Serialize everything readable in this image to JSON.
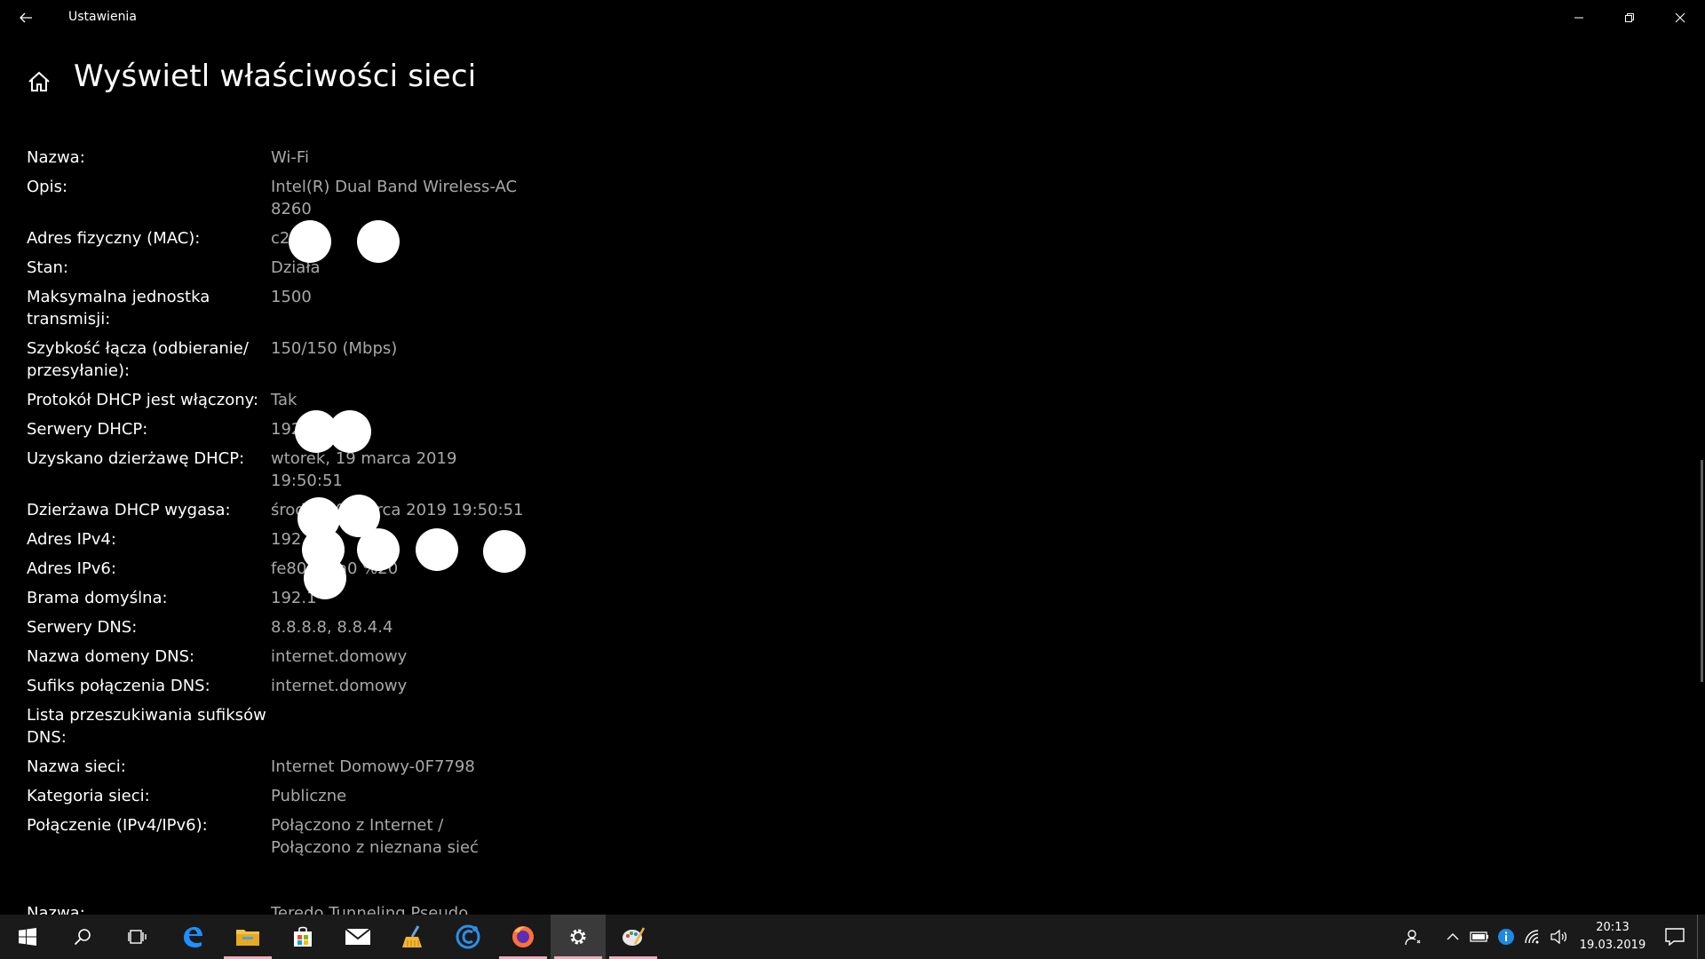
{
  "window": {
    "title": "Ustawienia"
  },
  "header": {
    "title": "Wyświetl właściwości sieci"
  },
  "properties": [
    {
      "label": "Nazwa:",
      "value": "Wi-Fi"
    },
    {
      "label": "Opis:",
      "value": "Intel(R) Dual Band Wireless-AC 8260"
    },
    {
      "label": "Adres fizyczny (MAC):",
      "value": "c2 40:6"
    },
    {
      "label": "Stan:",
      "value": "Działa"
    },
    {
      "label": "Maksymalna jednostka transmisji:",
      "value": "1500"
    },
    {
      "label": "Szybkość łącza (odbieranie/ przesyłanie):",
      "value": "150/150 (Mbps)"
    },
    {
      "label": "Protokół DHCP jest włączony:",
      "value": "Tak"
    },
    {
      "label": "Serwery DHCP:",
      "value": "192."
    },
    {
      "label": "Uzyskano dzierżawę DHCP:",
      "value": "wtorek, 19 marca 2019 19:50:51"
    },
    {
      "label": "Dzierżawa DHCP wygasa:",
      "value": "środa, 20 marca 2019 19:50:51"
    },
    {
      "label": "Adres IPv4:",
      "value": "192."
    },
    {
      "label": "Adres IPv6:",
      "value": "fe80: .2 a0 %20"
    },
    {
      "label": "Brama domyślna:",
      "value": "192.1"
    },
    {
      "label": "Serwery DNS:",
      "value": "8.8.8.8, 8.8.4.4"
    },
    {
      "label": "Nazwa domeny DNS:",
      "value": "internet.domowy"
    },
    {
      "label": "Sufiks połączenia DNS:",
      "value": "internet.domowy"
    },
    {
      "label": "Lista przeszukiwania sufiksów DNS:",
      "value": ""
    },
    {
      "label": "Nazwa sieci:",
      "value": "Internet Domowy-0F7798"
    },
    {
      "label": "Kategoria sieci:",
      "value": "Publiczne"
    },
    {
      "label": "Połączenie (IPv4/IPv6):",
      "value": "Połączono z Internet / Połączono z nieznana sieć"
    }
  ],
  "next_section": {
    "label": "Nazwa:",
    "value": "Teredo Tunneling Pseudo"
  },
  "taskbar": {
    "apps": [
      "start",
      "search",
      "task-view",
      "edge",
      "file-explorer",
      "store",
      "mail",
      "cleaner",
      "ccleaner-browser",
      "firefox",
      "settings",
      "paint"
    ],
    "active_app": "settings"
  },
  "tray": {
    "time": "20:13",
    "date": "19.03.2019"
  },
  "colors": {
    "background": "#000000",
    "label": "#ffffff",
    "value": "#a8a8a8",
    "taskbar": "#1a1a1a",
    "active_underline": "#f4aaba"
  }
}
